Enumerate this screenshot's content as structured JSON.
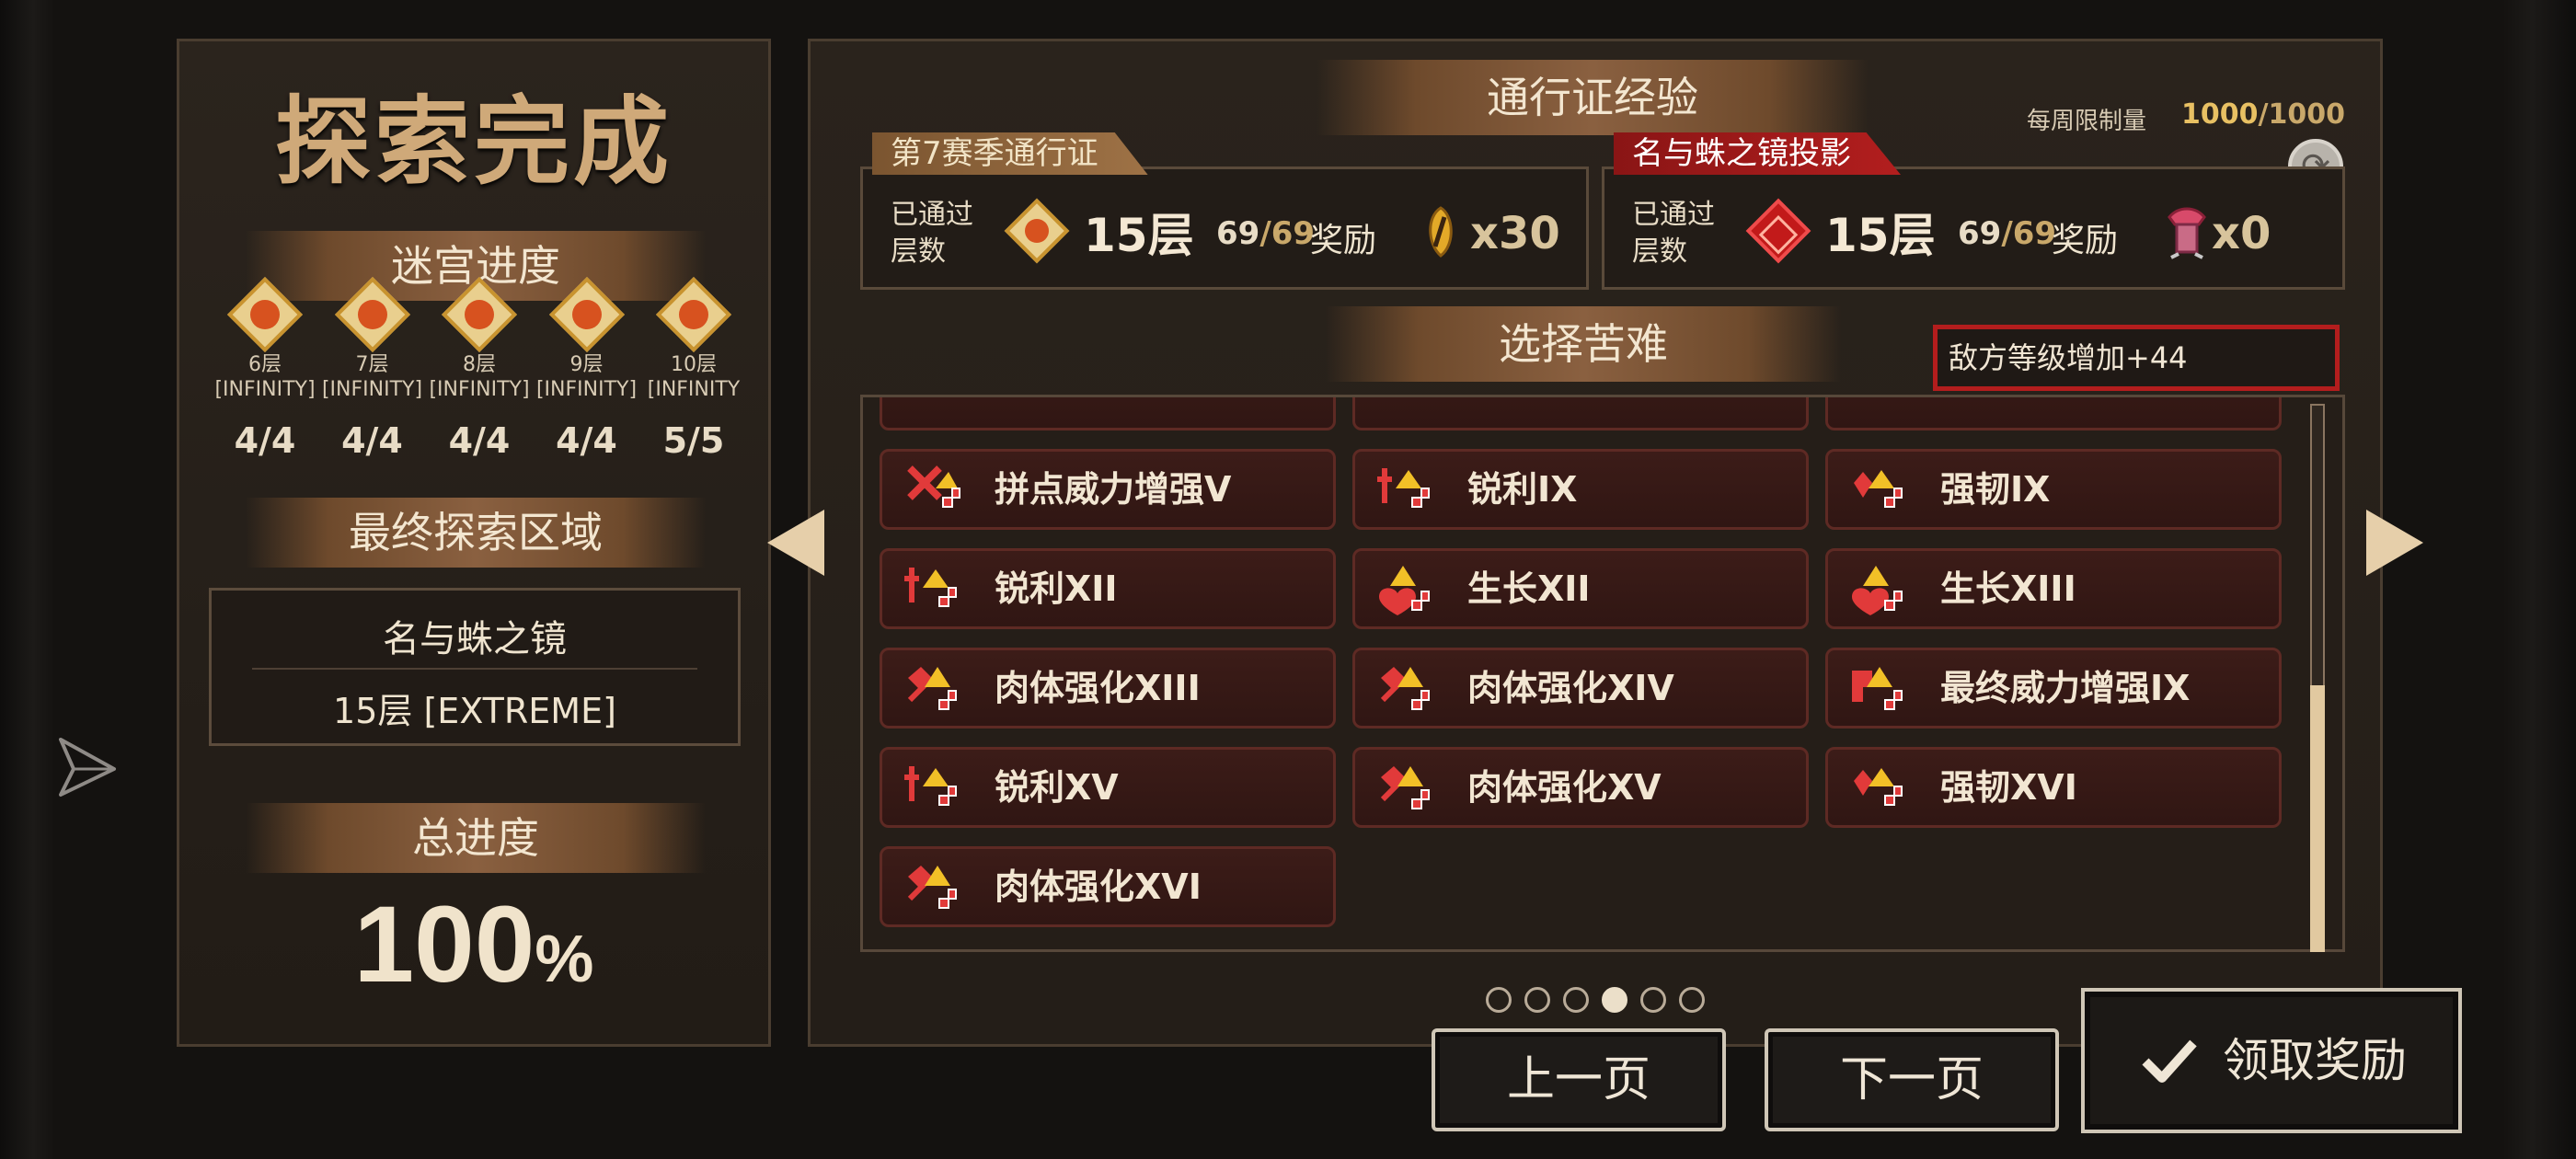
{
  "left": {
    "title": "探索完成",
    "labyrinth_banner": "迷宫进度",
    "floors": [
      {
        "name": "6层",
        "tag": "INFINITY]",
        "open": "[",
        "count": "4/4"
      },
      {
        "name": "7层",
        "tag": "[INFINITY]",
        "count": "4/4"
      },
      {
        "name": "8层",
        "tag": "[INFINITY]",
        "count": "4/4"
      },
      {
        "name": "9层",
        "tag": "[INFINITY]",
        "count": "4/4"
      },
      {
        "name": "10层",
        "tag": "[INFINITY",
        "count": "5/5"
      }
    ],
    "final_area_banner": "最终探索区域",
    "final_area_name": "名与蛛之镜",
    "final_area_level": "15层 [EXTREME]",
    "total_banner": "总进度",
    "total_value": "100",
    "total_unit": "%"
  },
  "right": {
    "pass_exp_banner": "通行证经验",
    "weekly_label": "每周限制量",
    "weekly_current": "1000",
    "weekly_max": "/1000",
    "season_pass": {
      "tab": "第7赛季通行证",
      "passed_label": "已通过层数",
      "floor": "15层",
      "count_current": "69",
      "count_max": "/69",
      "reward_label": "奖励",
      "reward_qty": "x30"
    },
    "mirror_pass": {
      "tab": "名与蛛之镜投影",
      "passed_label": "已通过层数",
      "floor": "15层",
      "count_current": "69",
      "count_max": "/69",
      "reward_label": "奖励",
      "reward_qty": "x0"
    },
    "hardship_banner": "选择苦难",
    "penalty": "敌方等级增加+44",
    "hardships": [
      {
        "label": "拼点威力增强V",
        "icon": "clash-power-icon"
      },
      {
        "label": "锐利IX",
        "icon": "sharp-icon"
      },
      {
        "label": "强韧IX",
        "icon": "toughness-icon"
      },
      {
        "label": "锐利XII",
        "icon": "sharp-icon"
      },
      {
        "label": "生长XII",
        "icon": "growth-icon"
      },
      {
        "label": "生长XIII",
        "icon": "growth-icon"
      },
      {
        "label": "肉体强化XIII",
        "icon": "body-enhance-icon"
      },
      {
        "label": "肉体强化XIV",
        "icon": "body-enhance-icon"
      },
      {
        "label": "最终威力增强IX",
        "icon": "final-power-icon"
      },
      {
        "label": "锐利XV",
        "icon": "sharp-icon"
      },
      {
        "label": "肉体强化XV",
        "icon": "body-enhance-icon"
      },
      {
        "label": "强韧XVI",
        "icon": "toughness-icon"
      },
      {
        "label": "肉体强化XVI",
        "icon": "body-enhance-icon"
      }
    ],
    "page_total": 6,
    "page_current": 4,
    "prev_page": "上一页",
    "next_page": "下一页",
    "claim": "领取奖励"
  },
  "colors": {
    "gold_text": "#cfa979",
    "penalty_border": "#b31d1d",
    "item_bg": "#3c1c18",
    "weekly_value": "#e8c063"
  }
}
